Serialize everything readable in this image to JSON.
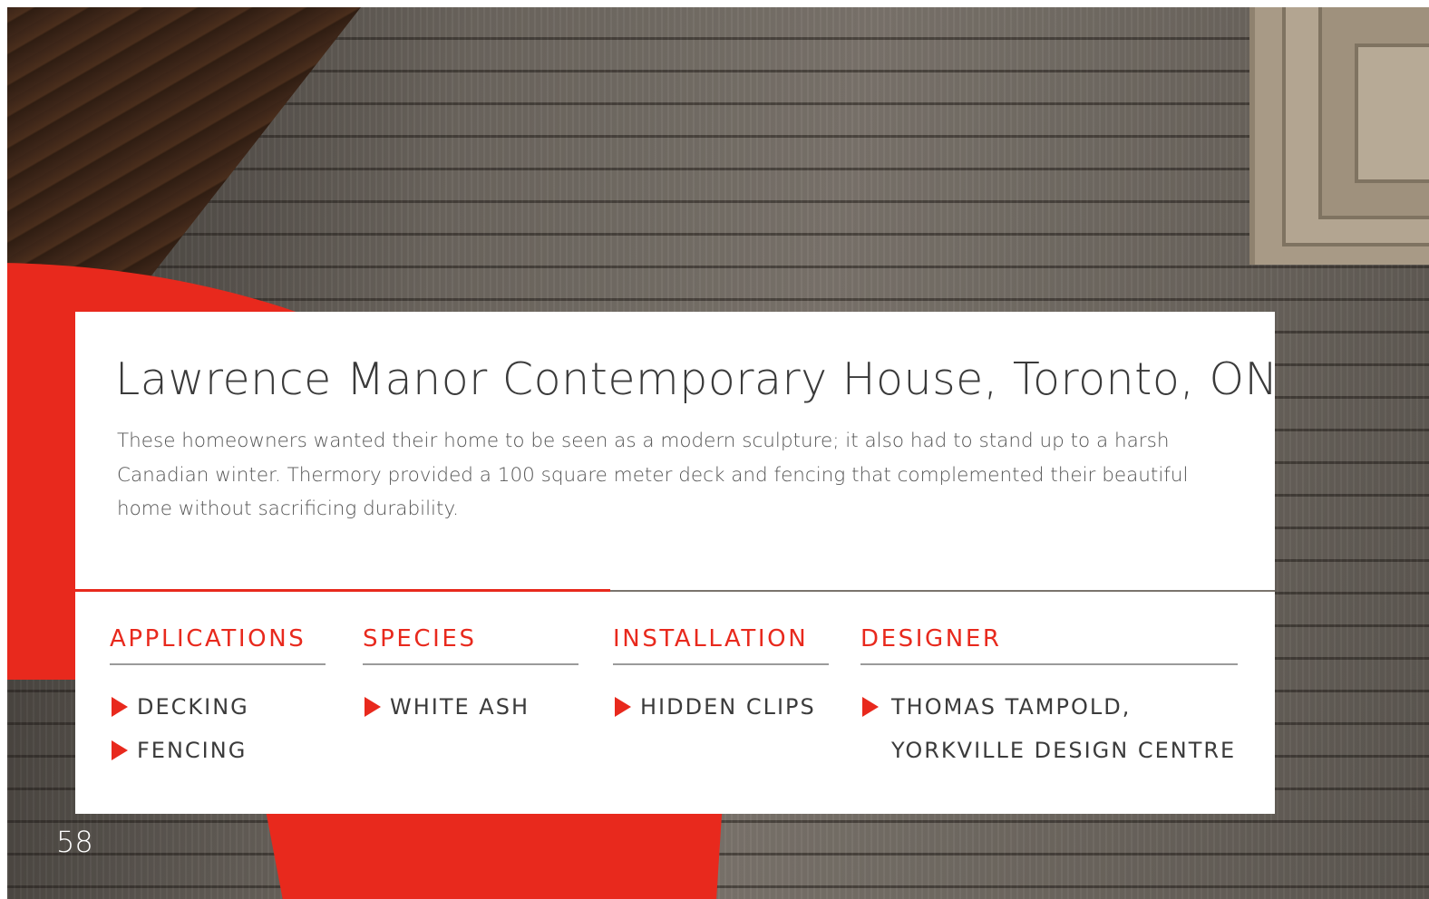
{
  "project": {
    "title": "Lawrence Manor Contemporary House, Toronto, ON",
    "description": "These homeowners wanted their home to be seen as a modern sculpture; it also had to stand up to a harsh Canadian winter. Thermory provided a 100 square meter deck and fencing that complemented their beautiful home without sacrificing durability."
  },
  "details": {
    "applications": {
      "heading": "APPLICATIONS",
      "items": [
        "DECKING",
        "FENCING"
      ]
    },
    "species": {
      "heading": "SPECIES",
      "items": [
        "WHITE ASH"
      ]
    },
    "installation": {
      "heading": "INSTALLATION",
      "items": [
        "HIDDEN CLIPS"
      ]
    },
    "designer": {
      "heading": "DESIGNER",
      "line1": "THOMAS TAMPOLD,",
      "line2": "YORKVILLE DESIGN CENTRE"
    }
  },
  "page_number": "58",
  "colors": {
    "accent": "#e8291d",
    "text": "#3b3b3b",
    "card": "#ffffff"
  },
  "icons": {
    "bullet": "red-triangle-bullet-icon"
  }
}
